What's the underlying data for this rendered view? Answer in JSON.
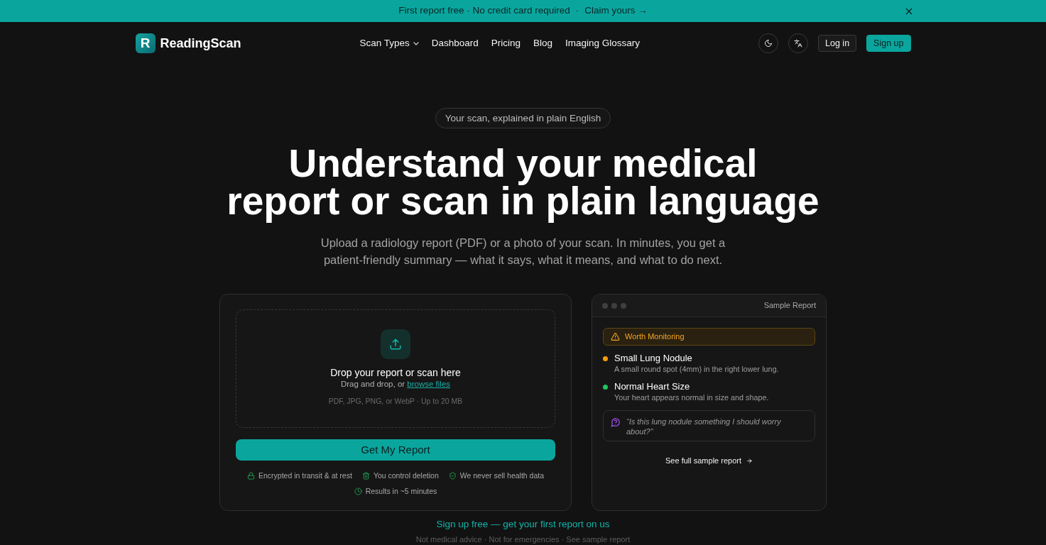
{
  "banner": {
    "text": "First report free · No credit card required",
    "separator": "·",
    "link": "Claim yours →"
  },
  "navbar": {
    "logo_mark": "R",
    "brand": "ReadingScan",
    "links": [
      {
        "label": "Scan Types",
        "kind": "dropdown"
      },
      {
        "label": "Dashboard",
        "kind": "link"
      },
      {
        "label": "Pricing",
        "kind": "link"
      },
      {
        "label": "Blog",
        "kind": "link"
      },
      {
        "label": "Imaging Glossary",
        "kind": "link"
      }
    ],
    "icon_buttons": [
      {
        "kind": "theme"
      },
      {
        "kind": "language"
      }
    ],
    "buttons": [
      {
        "label": "Log in",
        "kind": "outline"
      },
      {
        "label": "Sign up",
        "kind": "primary"
      }
    ]
  },
  "hero": {
    "eyebrow": "Your scan, explained in plain English",
    "title_lines": [
      "Understand your medical",
      "report or scan in plain language"
    ],
    "subtitle": "Upload a radiology report (PDF) or a photo of your scan. In minutes, you get a patient-friendly summary — what it says, what it means, and what to do next."
  },
  "upload": {
    "drop_title": "Drop your report or scan here",
    "drop_hint": "Drag and drop, or",
    "browse_link": "browse files",
    "formats": "PDF, JPG, PNG, or WebP · Up to 20 MB",
    "submit": "Get My Report",
    "assurances": [
      {
        "kind": "lock",
        "text": "Encrypted in transit & at rest"
      },
      {
        "kind": "trash",
        "text": "You control deletion"
      },
      {
        "kind": "shield",
        "text": "We never sell health data"
      },
      {
        "kind": "clock",
        "text": "Results in ~5 minutes"
      }
    ]
  },
  "sample_report": {
    "title": "Sample Report",
    "status": {
      "kind": "warning",
      "label": "Worth Monitoring"
    },
    "findings": [
      {
        "title": "Small Lung Nodule",
        "description": "A small round spot (4mm) in the right lower lung.",
        "color": "#f59e0b"
      },
      {
        "title": "Normal Heart Size",
        "description": "Your heart appears normal in size and shape.",
        "color": "#22c55e"
      }
    ],
    "question": "“Is this lung nodule something I should worry about?”",
    "link": "See full sample report"
  },
  "cta": "Sign up free — get your first report on us",
  "footnote": "Not medical advice · Not for emergencies · See sample report"
}
